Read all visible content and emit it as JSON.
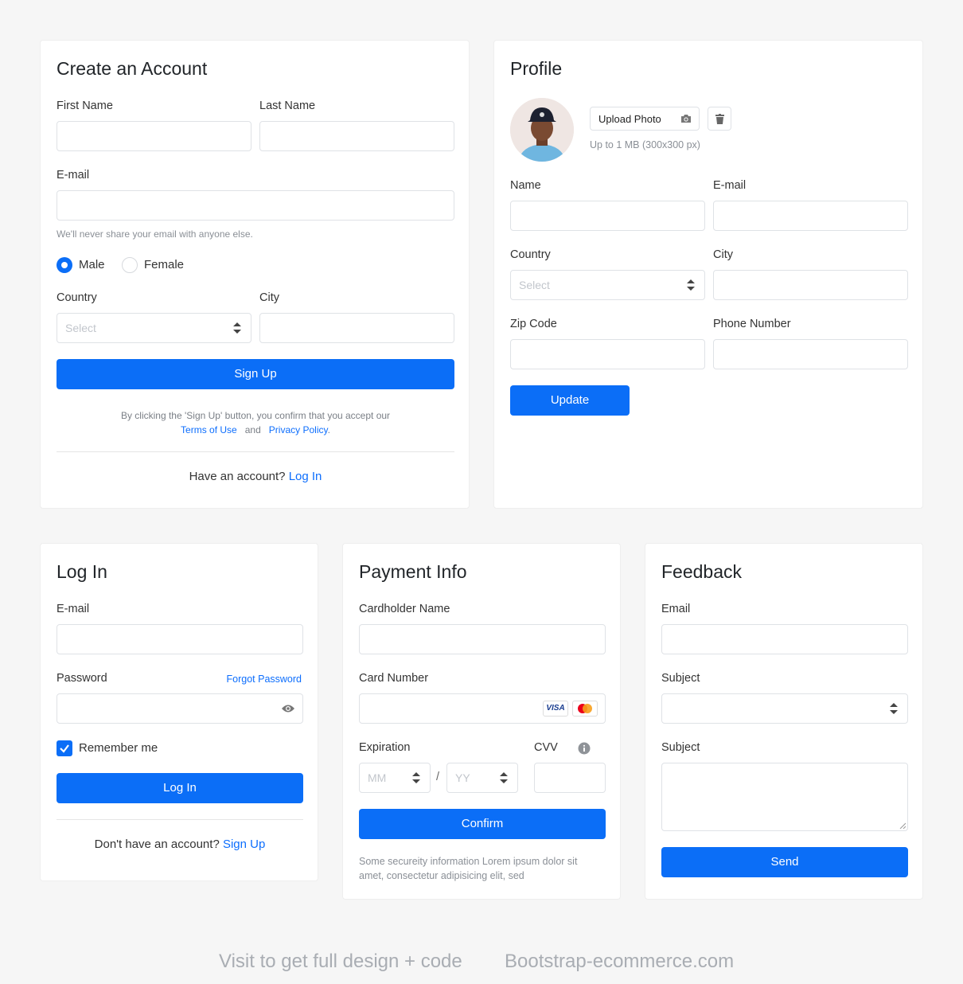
{
  "signup": {
    "title": "Create an Account",
    "first_name_label": "First Name",
    "last_name_label": "Last Name",
    "email_label": "E-mail",
    "email_help": "We'll never share your email with anyone else.",
    "gender_male": "Male",
    "gender_female": "Female",
    "country_label": "Country",
    "country_placeholder": "Select",
    "city_label": "City",
    "submit_label": "Sign Up",
    "terms_prefix": "By clicking the 'Sign Up' button, you confirm that you accept our",
    "terms_link": "Terms of Use",
    "terms_and": "and",
    "privacy_link": "Privacy Policy",
    "terms_suffix": ".",
    "have_account": "Have an account?",
    "login_link": "Log In"
  },
  "profile": {
    "title": "Profile",
    "upload_label": "Upload Photo",
    "upload_hint": "Up to 1 MB (300x300 px)",
    "name_label": "Name",
    "email_label": "E-mail",
    "country_label": "Country",
    "country_placeholder": "Select",
    "city_label": "City",
    "zip_label": "Zip Code",
    "phone_label": "Phone Number",
    "submit_label": "Update"
  },
  "login": {
    "title": "Log In",
    "email_label": "E-mail",
    "password_label": "Password",
    "forgot_link": "Forgot Password",
    "remember_label": "Remember me",
    "submit_label": "Log In",
    "no_account": "Don't have an account?",
    "signup_link": "Sign Up"
  },
  "payment": {
    "title": "Payment Info",
    "holder_label": "Cardholder Name",
    "card_label": "Card Number",
    "visa_label": "VISA",
    "expiration_label": "Expiration",
    "month_placeholder": "MM",
    "separator": "/",
    "year_placeholder": "YY",
    "cvv_label": "CVV",
    "submit_label": "Confirm",
    "security_note": "Some secureity information Lorem ipsum dolor sit amet, consectetur adipisicing elit, sed"
  },
  "feedback": {
    "title": "Feedback",
    "email_label": "Email",
    "subject_label": "Subject",
    "message_label": "Subject",
    "submit_label": "Send"
  },
  "footer": {
    "visit_text": "Visit to get full design + code",
    "site_text": "Bootstrap-ecommerce.com"
  },
  "colors": {
    "primary": "#0b6ef7",
    "background": "#f6f6f6",
    "border": "#dfe2e6",
    "muted": "#8a8f96"
  }
}
